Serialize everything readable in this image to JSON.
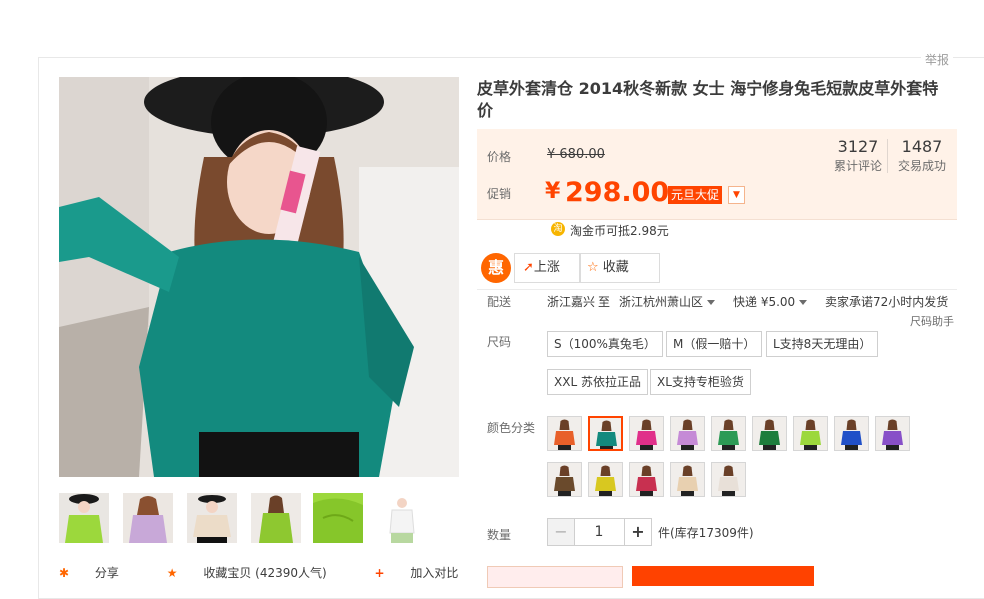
{
  "report_label": "举报",
  "product": {
    "title": "皮草外套清仓 2014秋冬新款 女士 海宁修身兔毛短款皮草外套特价"
  },
  "price": {
    "price_label": "价格",
    "original": "¥ 680.00",
    "promo_label": "促销",
    "currency": "¥",
    "promo_value": "298.00",
    "promo_badge": "元旦大促",
    "coin_icon": "淘",
    "coin_text": "淘金币可抵2.98元"
  },
  "stats": [
    {
      "value": "3127",
      "label": "累计评论"
    },
    {
      "value": "1487",
      "label": "交易成功"
    }
  ],
  "actions": {
    "hui_label": "惠",
    "rise_label": "上涨",
    "fav_label": "收藏"
  },
  "shipping": {
    "label": "配送",
    "from": "浙江嘉兴",
    "to_word": "至",
    "dest": "浙江杭州萧山区",
    "express": "快递 ¥5.00",
    "promise": "卖家承诺72小时内发货"
  },
  "size": {
    "label": "尺码",
    "helper": "尺码助手",
    "options": [
      "S（100%真兔毛）",
      "M（假一赔十）",
      "L支持8天无理由）",
      "XXL 苏依拉正品",
      "XL支持专柜验货"
    ]
  },
  "color": {
    "label": "颜色分类",
    "swatches": [
      "#e8602a",
      "#138a7e",
      "#e0308a",
      "#c58ad6",
      "#2c9a55",
      "#1d7d3c",
      "#9cd83c",
      "#2050c8",
      "#8850c8",
      "#6a4a2c",
      "#d8c820",
      "#c83050",
      "#e8d0b0",
      "#e8e0d8"
    ],
    "selected_index": 1
  },
  "quantity": {
    "label": "数量",
    "minus": "−",
    "value": "1",
    "plus": "+",
    "stock": "件(库存17309件)"
  },
  "share_row": {
    "share": "分享",
    "collect": "收藏宝贝 (42390人气)",
    "compare": "加入对比"
  },
  "colors": {
    "accent": "#ff4400",
    "price_bg": "#fff2e8",
    "coat": "#138a7e"
  }
}
